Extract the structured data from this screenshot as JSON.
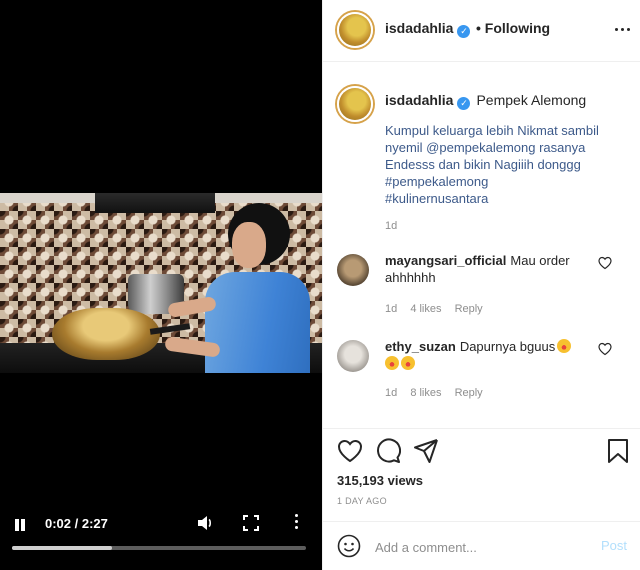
{
  "video": {
    "time": "0:02 / 2:27",
    "progress": 0.34
  },
  "post": {
    "username": "isdadahlia",
    "follow_label": "• Following",
    "caption_title": "Pempek Alemong",
    "caption_lines": [
      "Kumpul keluarga lebih Nikmat sambil",
      "nyemil @pempekalemong rasanya",
      "Endesss dan bikin Nagiiih donggg"
    ],
    "hashtags": [
      "#pempekalemong",
      "#kulinernusantara"
    ],
    "caption_time": "1d"
  },
  "comments": [
    {
      "user": "mayangsari_official",
      "text": "Mau order ahhhhhh",
      "time": "1d",
      "likes": "4 likes",
      "reply": "Reply"
    },
    {
      "user": "ethy_suzan",
      "text": "Dapurnya bguus",
      "time": "1d",
      "likes": "8 likes",
      "reply": "Reply"
    }
  ],
  "stats": {
    "views": "315,193 views",
    "date": "1 DAY AGO"
  },
  "comment_box": {
    "placeholder": "Add a comment...",
    "post_label": "Post"
  },
  "colors": {
    "verified": "#3897f0",
    "link": "#3d5a8a",
    "post_disabled": "#b2dffc"
  }
}
